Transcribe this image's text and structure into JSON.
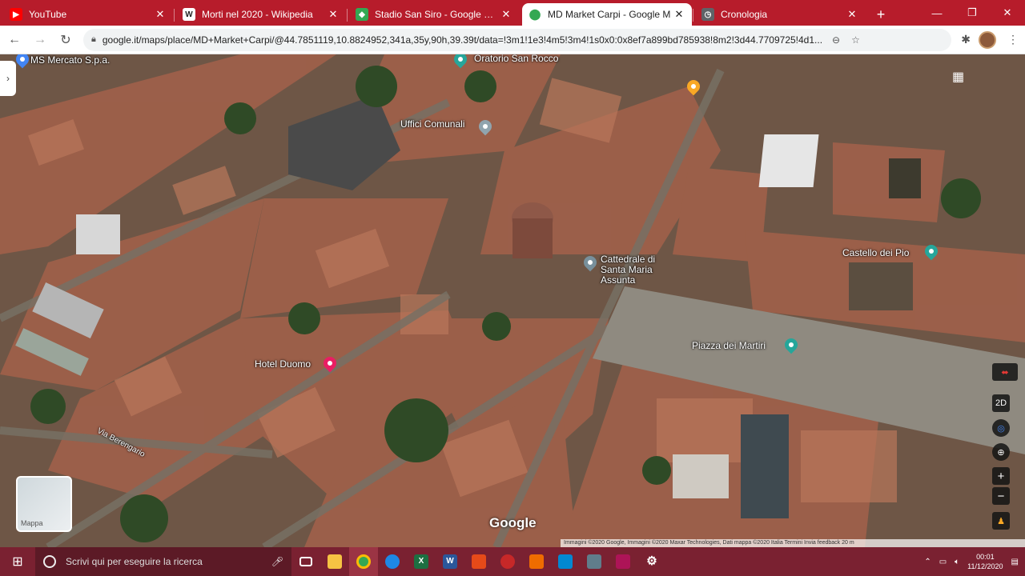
{
  "tabs": [
    {
      "title": "YouTube",
      "favicon_color": "#ff0000",
      "active": false
    },
    {
      "title": "Morti nel 2020 - Wikipedia",
      "favicon_color": "#ffffff",
      "active": false
    },
    {
      "title": "Stadio San Siro - Google Maps",
      "favicon_color": "#34a853",
      "active": false
    },
    {
      "title": "MD Market Carpi - Google M",
      "favicon_color": "#34a853",
      "active": true
    },
    {
      "title": "Cronologia",
      "favicon_color": "#5f6368",
      "active": false
    }
  ],
  "address_bar": {
    "url": "google.it/maps/place/MD+Market+Carpi/@44.7851119,10.8824952,341a,35y,90h,39.39t/data=!3m1!1e3!4m5!3m4!1s0x0:0x8ef7a899bd785938!8m2!3d44.7709725!4d1..."
  },
  "map": {
    "labels": {
      "mercato": "MS Mercato S.p.a.",
      "oratorio": "Oratorio San Rocco",
      "uffici": "Uffici Comunali",
      "cattedrale": "Cattedrale di Santa Maria Assunta",
      "castello": "Castello dei Pio",
      "piazza": "Piazza dei Martiri",
      "hotel": "Hotel Duomo",
      "street": "Via Berengario"
    },
    "google_logo": "Google",
    "minimap_label": "Mappa",
    "attribution": "Immagini ©2020 Google, Immagini ©2020 Maxar Technologies, Dati mappa ©2020   Italia   Termini   Invia feedback   20 m",
    "controls": {
      "compass": "⬌",
      "view_2d": "2D",
      "locate": "◎",
      "tilt": "⊕",
      "zoom_in": "+",
      "zoom_out": "−",
      "pegman": "♟"
    }
  },
  "taskbar": {
    "search_placeholder": "Scrivi qui per eseguire la ricerca",
    "time": "00:01",
    "date": "11/12/2020"
  }
}
